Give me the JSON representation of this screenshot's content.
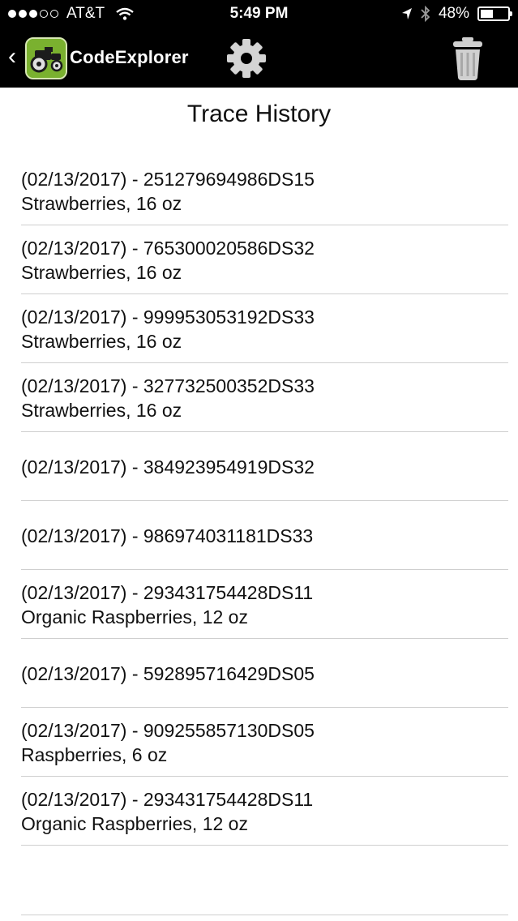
{
  "status_bar": {
    "carrier": "AT&T",
    "time": "5:49 PM",
    "battery_percent": "48%",
    "battery_level": 0.48,
    "signal_bars_filled": 3,
    "signal_bars_total": 5
  },
  "navbar": {
    "back_glyph": "‹",
    "app_title": "CodeExplorer",
    "icons": [
      "app-icon",
      "gear-icon",
      "trash-icon"
    ]
  },
  "page": {
    "title": "Trace History"
  },
  "history": [
    {
      "line1": "(02/13/2017) - 251279694986DS15",
      "line2": "Strawberries, 16 oz"
    },
    {
      "line1": "(02/13/2017) - 765300020586DS32",
      "line2": "Strawberries, 16 oz"
    },
    {
      "line1": "(02/13/2017) - 999953053192DS33",
      "line2": "Strawberries, 16 oz"
    },
    {
      "line1": "(02/13/2017) - 327732500352DS33",
      "line2": "Strawberries, 16 oz"
    },
    {
      "line1": "(02/13/2017) - 384923954919DS32",
      "line2": ""
    },
    {
      "line1": "(02/13/2017) - 986974031181DS33",
      "line2": ""
    },
    {
      "line1": "(02/13/2017) - 293431754428DS11",
      "line2": "Organic Raspberries, 12 oz"
    },
    {
      "line1": "(02/13/2017) - 592895716429DS05",
      "line2": ""
    },
    {
      "line1": "(02/13/2017) - 909255857130DS05",
      "line2": "Raspberries, 6 oz"
    },
    {
      "line1": "(02/13/2017) - 293431754428DS11",
      "line2": "Organic Raspberries, 12 oz"
    }
  ],
  "colors": {
    "topbar": "#000000",
    "app_icon": "#7ab12f",
    "divider": "#cfcfcf"
  }
}
